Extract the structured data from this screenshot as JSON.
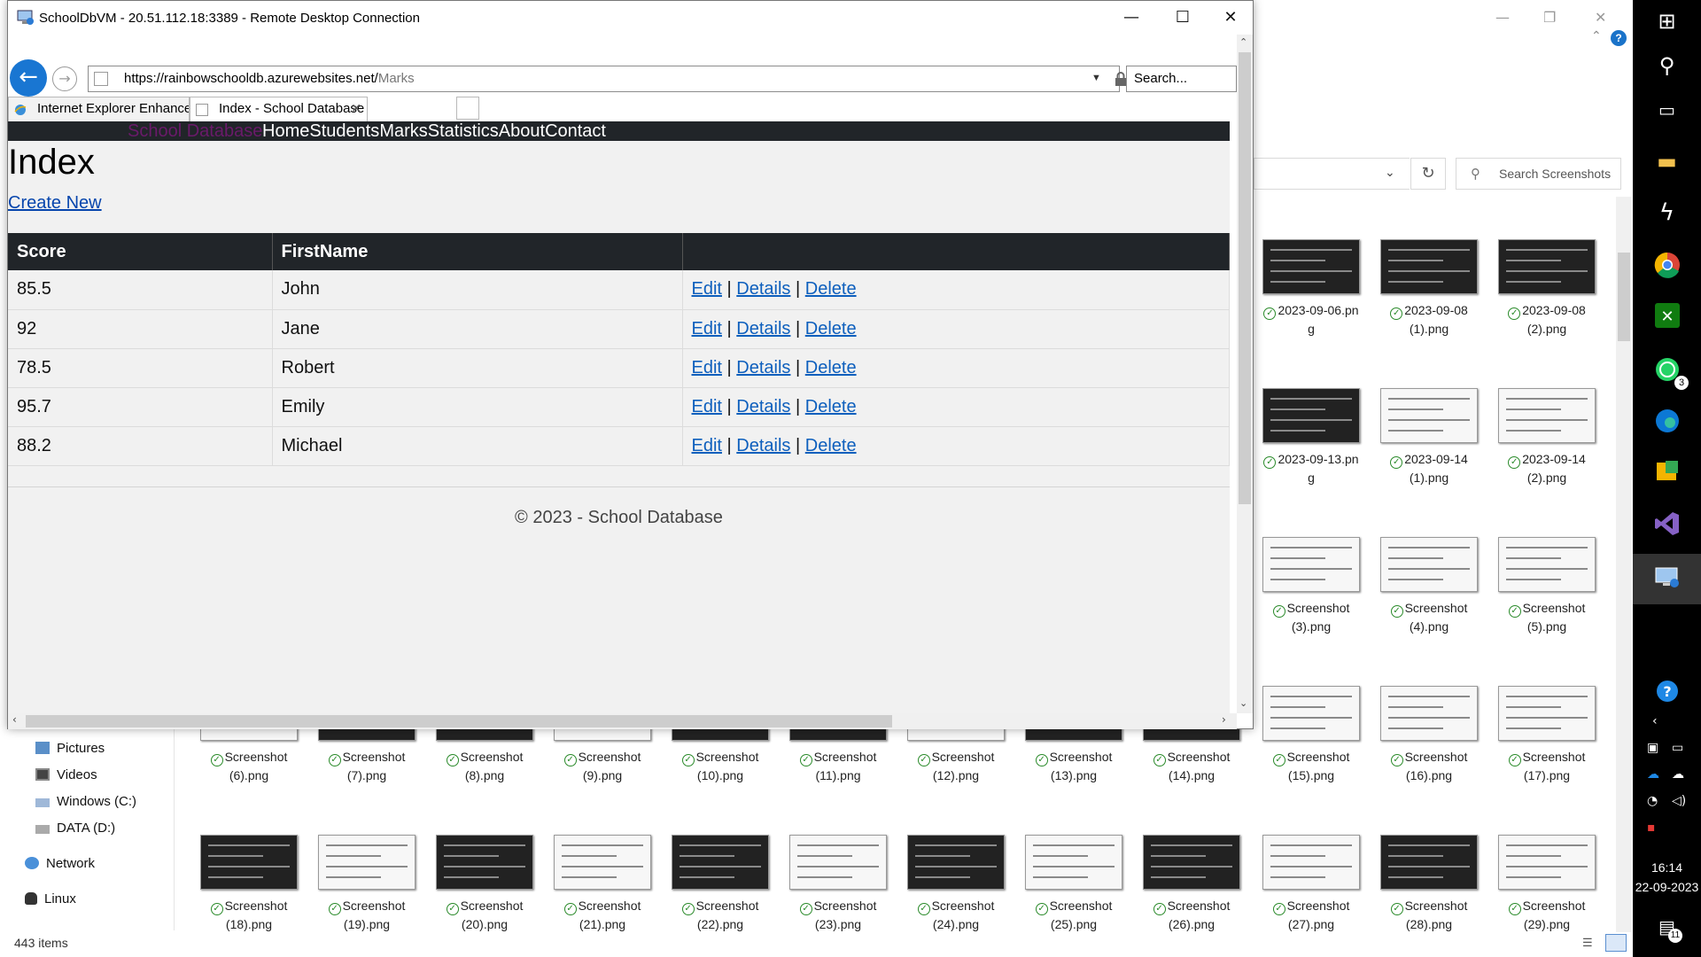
{
  "rdp": {
    "title": "SchoolDbVM - 20.51.112.18:3389 - Remote Desktop Connection",
    "minimize": "—",
    "maximize": "☐",
    "close": "✕"
  },
  "ie": {
    "url_base": "https://rainbowschooldb.azurewebsites.net/",
    "url_path": "Marks",
    "search_placeholder": "Search...",
    "tabs": [
      {
        "label": "Internet Explorer Enhanced Sec..."
      },
      {
        "label": "Index - School Database",
        "close": "✕"
      }
    ]
  },
  "site": {
    "brand": "School Database",
    "nav": [
      "Home",
      "Students",
      "Marks",
      "Statistics",
      "About",
      "Contact"
    ],
    "page_title": "Index",
    "create_new": "Create New",
    "columns": [
      "Score",
      "FirstName",
      ""
    ],
    "rows": [
      {
        "score": "85.5",
        "first_name": "John"
      },
      {
        "score": "92",
        "first_name": "Jane"
      },
      {
        "score": "78.5",
        "first_name": "Robert"
      },
      {
        "score": "95.7",
        "first_name": "Emily"
      },
      {
        "score": "88.2",
        "first_name": "Michael"
      }
    ],
    "actions": {
      "edit": "Edit",
      "sep": "|",
      "details": "Details",
      "delete": "Delete"
    },
    "footer": "© 2023 - School Database"
  },
  "explorer": {
    "search_placeholder": "Search Screenshots",
    "status": "443 items",
    "nav_items": [
      "Pictures",
      "Videos",
      "Windows (C:)",
      "DATA (D:)",
      "Network",
      "Linux"
    ],
    "thumbnails_right": [
      {
        "l1": "2023-09-06.pn",
        "l2": "g",
        "style": "dark"
      },
      {
        "l1": "2023-09-08",
        "l2": "(1).png",
        "style": "dark"
      },
      {
        "l1": "2023-09-08",
        "l2": "(2).png",
        "style": "dark"
      },
      {
        "l1": "2023-09-13.pn",
        "l2": "g",
        "style": "dark"
      },
      {
        "l1": "2023-09-14",
        "l2": "(1).png",
        "style": "light"
      },
      {
        "l1": "2023-09-14",
        "l2": "(2).png",
        "style": "light"
      },
      {
        "l1": "Screenshot",
        "l2": "(3).png",
        "style": "light"
      },
      {
        "l1": "Screenshot",
        "l2": "(4).png",
        "style": "light"
      },
      {
        "l1": "Screenshot",
        "l2": "(5).png",
        "style": "light"
      },
      {
        "l1": "Screenshot",
        "l2": "(15).png",
        "style": "light"
      },
      {
        "l1": "Screenshot",
        "l2": "(16).png",
        "style": "light"
      },
      {
        "l1": "Screenshot",
        "l2": "(17).png",
        "style": "light"
      }
    ],
    "row4_labels": [
      "(6).png",
      "(7).png",
      "(8).png",
      "(9).png",
      "(10).png",
      "(11).png",
      "(12).png",
      "(13).png",
      "(14).png"
    ],
    "row5_labels": [
      "(18).png",
      "(19).png",
      "(20).png",
      "(21).png",
      "(22).png",
      "(23).png",
      "(24).png",
      "(25).png",
      "(26).png",
      "(27).png",
      "(28).png",
      "(29).png"
    ],
    "screenshot_word": "Screenshot"
  },
  "taskbar": {
    "time": "16:14",
    "date": "22-09-2023",
    "whatsapp_badge": "3",
    "notification_badge": "11"
  }
}
